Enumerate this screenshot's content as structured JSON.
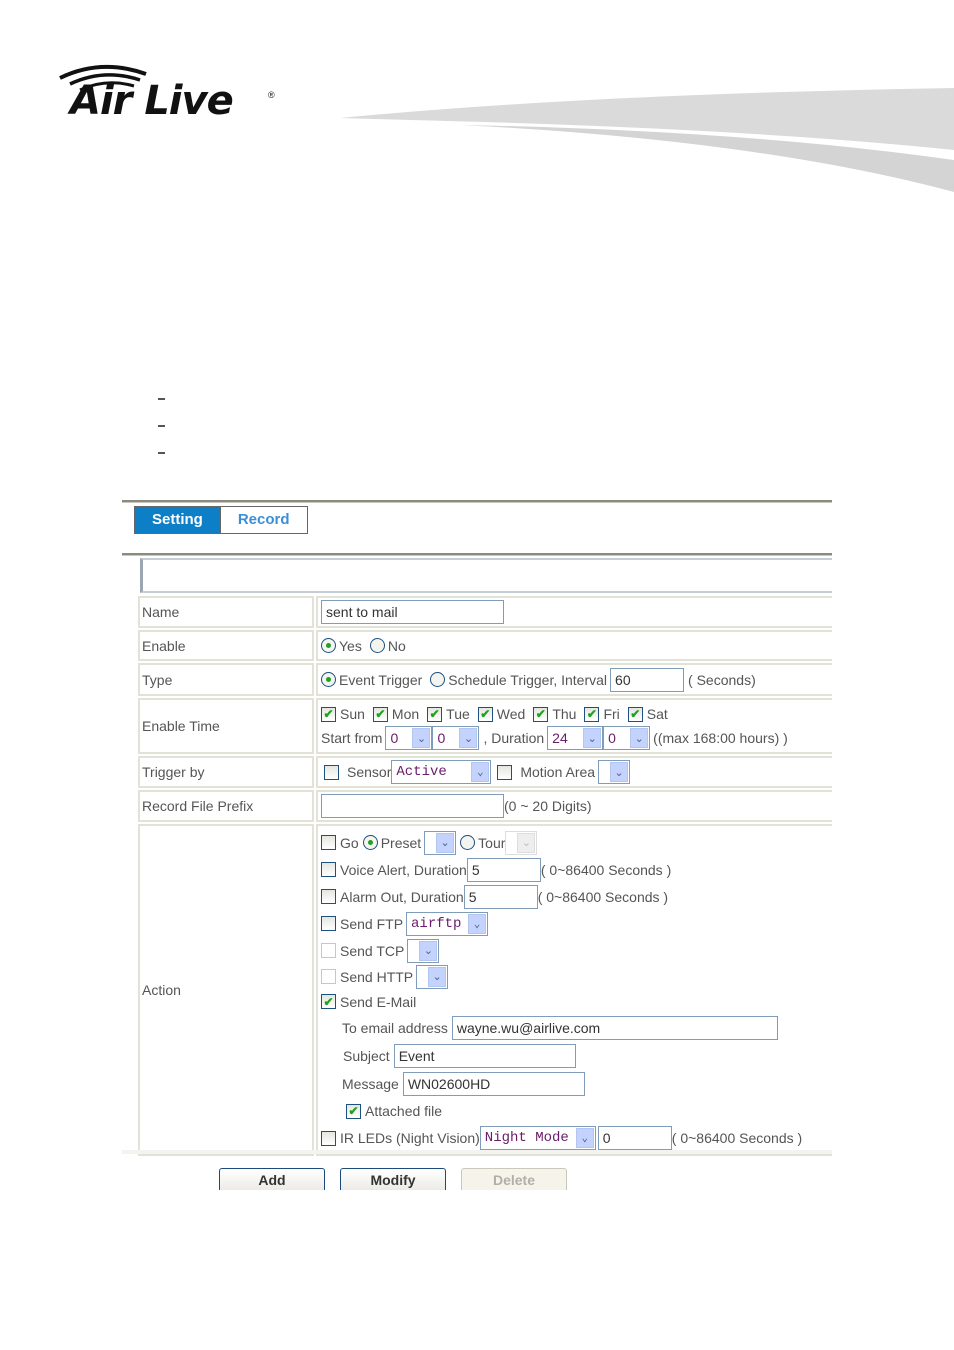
{
  "brand": {
    "name": "Air Live",
    "registered": "®"
  },
  "tabs": [
    {
      "label": "Setting",
      "active": true
    },
    {
      "label": "Record",
      "active": false
    }
  ],
  "form": {
    "name": {
      "label": "Name",
      "value": "sent to mail"
    },
    "enable": {
      "label": "Enable",
      "options": [
        "Yes",
        "No"
      ],
      "selected": "Yes"
    },
    "type": {
      "label": "Type",
      "event_trigger": "Event Trigger",
      "schedule_trigger": "Schedule Trigger, Interval",
      "selected": "Event Trigger",
      "interval_value": "60",
      "interval_unit": "( Seconds)"
    },
    "enable_time": {
      "label": "Enable Time",
      "days": [
        {
          "label": "Sun",
          "checked": true
        },
        {
          "label": "Mon",
          "checked": true
        },
        {
          "label": "Tue",
          "checked": true
        },
        {
          "label": "Wed",
          "checked": true
        },
        {
          "label": "Thu",
          "checked": true
        },
        {
          "label": "Fri",
          "checked": true
        },
        {
          "label": "Sat",
          "checked": true
        }
      ],
      "start_from_label": "Start from",
      "start_hour": "0",
      "start_minute": "0",
      "duration_label": ", Duration",
      "duration_hour": "24",
      "duration_minute": "0",
      "max_note": "((max 168:00 hours) )"
    },
    "trigger_by": {
      "label": "Trigger by",
      "sensor_label": "Sensor",
      "sensor_checked": false,
      "sensor_value": "Active",
      "motion_label": "Motion Area",
      "motion_checked": false,
      "motion_value": ""
    },
    "record_prefix": {
      "label": "Record File Prefix",
      "value": "",
      "note": "(0 ~ 20 Digits)"
    },
    "action": {
      "label": "Action",
      "go_label": "Go",
      "go_checked": false,
      "preset_label": "Preset",
      "tour_label": "Tour",
      "go_selected": "Preset",
      "voice_label": "Voice Alert, Duration",
      "voice_value": "5",
      "voice_note": "( 0~86400 Seconds )",
      "alarm_label": "Alarm Out, Duration",
      "alarm_value": "5",
      "alarm_note": "( 0~86400 Seconds )",
      "ftp_label": "Send FTP",
      "ftp_value": "airftp",
      "tcp_label": "Send TCP",
      "http_label": "Send HTTP",
      "email_label": "Send E-Mail",
      "email_checked": true,
      "to_label": "To email address",
      "to_value": "wayne.wu@airlive.com",
      "subject_label": "Subject",
      "subject_value": "Event",
      "message_label": "Message",
      "message_value": "WN02600HD",
      "attached_label": "Attached file",
      "attached_checked": true,
      "ir_label": "IR LEDs (Night Vision)",
      "ir_mode": "Night Mode",
      "ir_value": "0",
      "ir_note": "( 0~86400 Seconds )"
    }
  },
  "buttons": {
    "add": "Add",
    "modify": "Modify",
    "delete": "Delete"
  },
  "icons": {
    "checkmark": "✔",
    "dropdown_arrow": "⌄"
  }
}
